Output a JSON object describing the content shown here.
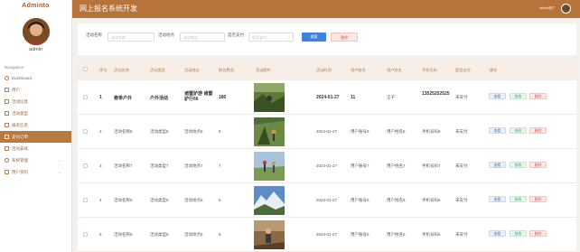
{
  "app": {
    "brand": "Adminto",
    "user_name": "admin",
    "header_user": "admin用户"
  },
  "header": {
    "title": "网上报名系统开发"
  },
  "sidebar": {
    "section_title": "Navigation",
    "items": [
      {
        "label": "Dashboard",
        "icon": "dashboard-icon"
      },
      {
        "label": "用户",
        "icon": "user-icon"
      },
      {
        "label": "活动信息",
        "icon": "list-icon"
      },
      {
        "label": "活动类型",
        "icon": "list-icon"
      },
      {
        "label": "报名信息",
        "icon": "list-icon"
      },
      {
        "label": "支付订单",
        "icon": "list-icon",
        "active": true
      },
      {
        "label": "活动安排",
        "icon": "list-icon"
      },
      {
        "label": "系统管理",
        "icon": "gear-icon",
        "has_children": true
      },
      {
        "label": "用户资料",
        "icon": "user-icon",
        "has_children": true
      }
    ]
  },
  "search": {
    "fields": [
      {
        "label": "活动名称",
        "placeholder": "活动名称"
      },
      {
        "label": "活动地点",
        "placeholder": "活动地点"
      },
      {
        "label": "是否支付",
        "placeholder": "是否支付"
      }
    ],
    "search_label": "搜索",
    "delete_label": "删除"
  },
  "table": {
    "headers": [
      "序号",
      "活动名称",
      "活动类型",
      "活动地点",
      "报名费用",
      "活动图片",
      "活动时间",
      "用户账号",
      "用户姓名",
      "手机号码",
      "是否支付",
      "操作"
    ],
    "actions": {
      "view": "查看",
      "edit": "修改",
      "delete": "删除"
    },
    "rows": [
      {
        "index": "1",
        "name": "春季户外",
        "type": "户外活动",
        "place": "诸暨驴游 诸暨驴行66",
        "fee": "180",
        "date": "2024-01-27",
        "account": "11",
        "username": "王子",
        "phone": "13525252525",
        "paid": "未支付",
        "bold": true
      },
      {
        "index": "2",
        "name": "活动名称8",
        "type": "活动类型8",
        "place": "活动地点8",
        "fee": "8",
        "date": "2024-01-27",
        "account": "用户账号8",
        "username": "用户姓名8",
        "phone": "手机号码8",
        "paid": "未支付",
        "bold": false
      },
      {
        "index": "3",
        "name": "活动名称7",
        "type": "活动类型7",
        "place": "活动地点7",
        "fee": "7",
        "date": "2024-01-27",
        "account": "用户账号7",
        "username": "用户姓名7",
        "phone": "手机号码7",
        "paid": "未支付",
        "bold": false
      },
      {
        "index": "4",
        "name": "活动名称6",
        "type": "活动类型6",
        "place": "活动地点6",
        "fee": "6",
        "date": "2024-01-27",
        "account": "用户账号6",
        "username": "用户姓名6",
        "phone": "手机号码6",
        "paid": "未支付",
        "bold": false
      },
      {
        "index": "5",
        "name": "活动名称5",
        "type": "活动类型5",
        "place": "活动地点5",
        "fee": "5",
        "date": "2024-01-27",
        "account": "用户账号5",
        "username": "用户姓名5",
        "phone": "手机号码5",
        "paid": "未支付",
        "bold": false
      }
    ]
  },
  "colors": {
    "accent": "#b6743a",
    "primary": "#3c84e0",
    "danger": "#e05a48",
    "success": "#43a665"
  }
}
